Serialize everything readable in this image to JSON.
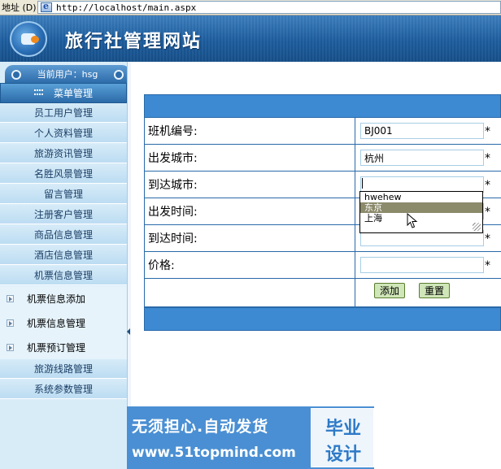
{
  "browser": {
    "address_label": "地址 (D)",
    "url": "http://localhost/main.aspx"
  },
  "header": {
    "site_title": "旅行社管理网站"
  },
  "sidebar": {
    "current_user": "当前用户：hsg",
    "menu_header": "菜单管理",
    "items": [
      {
        "label": "员工用户管理"
      },
      {
        "label": "个人资料管理"
      },
      {
        "label": "旅游资讯管理"
      },
      {
        "label": "名胜风景管理"
      },
      {
        "label": "留言管理"
      },
      {
        "label": "注册客户管理"
      },
      {
        "label": "商品信息管理"
      },
      {
        "label": "酒店信息管理"
      },
      {
        "label": "机票信息管理"
      }
    ],
    "subitems": [
      {
        "label": "机票信息添加"
      },
      {
        "label": "机票信息管理"
      },
      {
        "label": "机票预订管理"
      }
    ],
    "items_after": [
      {
        "label": "旅游线路管理"
      },
      {
        "label": "系统参数管理"
      }
    ]
  },
  "form": {
    "rows": [
      {
        "label": "班机编号:",
        "value": "BJ001",
        "required": "*"
      },
      {
        "label": "出发城市:",
        "value": "杭州",
        "required": "*"
      },
      {
        "label": "到达城市:",
        "value": "",
        "required": "*"
      },
      {
        "label": "出发时间:",
        "value": "",
        "required": "*"
      },
      {
        "label": "到达时间:",
        "value": "",
        "required": "*"
      },
      {
        "label": "价格:",
        "value": "",
        "required": "*"
      }
    ],
    "add_label": "添加",
    "reset_label": "重置",
    "autocomplete": [
      {
        "label": "hwehew"
      },
      {
        "label": "东京"
      },
      {
        "label": "上海"
      }
    ]
  },
  "watermark": {
    "line1": "无须担心.自动发货",
    "line2": "www.51topmind.com",
    "badge_line1": "毕业",
    "badge_line2": "设计"
  }
}
